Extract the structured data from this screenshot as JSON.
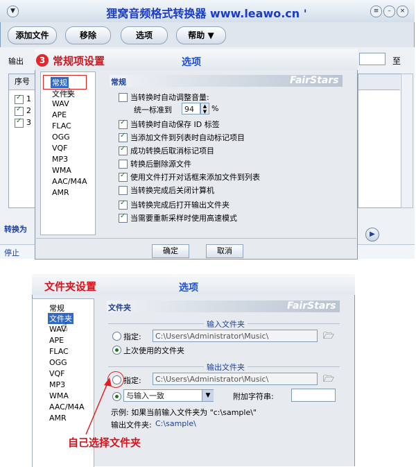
{
  "app": {
    "title": "狸窝音频格式转换器 www.leawo.cn '",
    "toolbar": [
      "添加文件",
      "移除",
      "选项",
      "帮助 ▼"
    ],
    "output_label": "输出",
    "to_label": "至",
    "table_header_index": "序号",
    "rows": [
      "1",
      "2",
      "3"
    ],
    "convert_to_label": "转换为",
    "stop_label": "停止",
    "play_icon": "play-icon"
  },
  "dialog1": {
    "annotation_number": "3",
    "annotation": "常规项设置",
    "title": "选项",
    "nav": [
      "常规",
      "文件夹",
      "WAV",
      "APE",
      "FLAC",
      "OGG",
      "VQF",
      "MP3",
      "WMA",
      "AAC/M4A",
      "AMR"
    ],
    "selected_nav": "常规",
    "section_title": "常规",
    "brand": "FairStars",
    "options": [
      {
        "label": "当转换时自动调整音量:",
        "checked": false
      },
      {
        "label": "当转换时自动保存 ID 标签",
        "checked": true
      },
      {
        "label": "当添加文件到列表时自动标记项目",
        "checked": true
      },
      {
        "label": "成功转换后取消标记项目",
        "checked": true
      },
      {
        "label": "转换后删除源文件",
        "checked": false
      },
      {
        "label": "使用文件打开对话框来添加文件到列表",
        "checked": true
      },
      {
        "label": "当转换完成后关闭计算机",
        "checked": false
      },
      {
        "label": "当转换完成后打开输出文件夹",
        "checked": true
      },
      {
        "label": "当需要重新采样时使用高速模式",
        "checked": true
      }
    ],
    "normalize_label": "统一标准到",
    "normalize_value": "94",
    "normalize_unit": "%",
    "ok": "确定",
    "cancel": "取消"
  },
  "dialog2": {
    "annotation": "文件夹设置",
    "title": "选项",
    "nav": [
      "常规",
      "文件夹",
      "WAV",
      "APE",
      "FLAC",
      "OGG",
      "VQF",
      "MP3",
      "WMA",
      "AAC/M4A",
      "AMR"
    ],
    "selected_nav": "文件夹",
    "section_title": "文件夹",
    "brand": "FairStars",
    "input_group": "输入文件夹",
    "specify_label": "指定:",
    "input_path": "C:\\Users\\Administrator\\Music\\",
    "last_used_label": "上次使用的文件夹",
    "output_group": "输出文件夹",
    "output_path": "C:\\Users\\Administrator\\Music\\",
    "same_as_input": "与输入一致",
    "append_label": "附加字符串:",
    "append_value": "",
    "example_text": "示例: 如果当前输入文件夹为 \"c:\\sample\\\"",
    "output_folder_label": "输出文件夹:",
    "output_folder_value": "C:\\sample\\",
    "callout": "自己选择文件夹"
  }
}
